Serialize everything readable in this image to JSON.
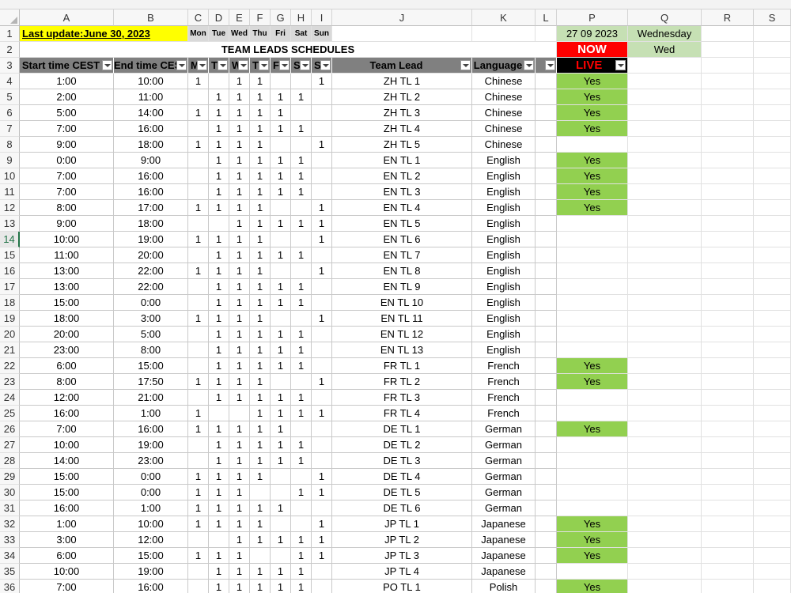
{
  "colors": {
    "yes_green": "#92d050",
    "date_green": "#c6e0b4",
    "now_red": "#ff0000",
    "update_yellow": "#ffff00",
    "header_gray": "#808080"
  },
  "columns": [
    "A",
    "B",
    "C",
    "D",
    "E",
    "F",
    "G",
    "H",
    "I",
    "J",
    "K",
    "L",
    "P",
    "Q",
    "R",
    "S"
  ],
  "row1": {
    "update": "Last update:June 30, 2023",
    "days": [
      "Mon",
      "Tue",
      "Wed",
      "Thu",
      "Fri",
      "Sat",
      "Sun"
    ],
    "date": "27 09 2023",
    "weekday": "Wednesday"
  },
  "row2": {
    "title": "TEAM LEADS SCHEDULES",
    "now": "NOW",
    "weekday_short": "Wed"
  },
  "row3": {
    "start": "Start time CEST",
    "end": "End time CEST",
    "day_letters": [
      "M",
      "T",
      "W",
      "T",
      "F",
      "S",
      "S"
    ],
    "team_lead": "Team Lead",
    "language": "Language",
    "live": "LIVE"
  },
  "rows": [
    {
      "n": "4",
      "start": "1:00",
      "end": "10:00",
      "days": [
        "1",
        "",
        "1",
        "1",
        "",
        "",
        "1"
      ],
      "lead": "ZH TL 1",
      "lang": "Chinese",
      "live": "Yes"
    },
    {
      "n": "5",
      "start": "2:00",
      "end": "11:00",
      "days": [
        "",
        "1",
        "1",
        "1",
        "1",
        "1",
        ""
      ],
      "lead": "ZH TL 2",
      "lang": "Chinese",
      "live": "Yes"
    },
    {
      "n": "6",
      "start": "5:00",
      "end": "14:00",
      "days": [
        "1",
        "1",
        "1",
        "1",
        "1",
        "",
        ""
      ],
      "lead": "ZH TL 3",
      "lang": "Chinese",
      "live": "Yes"
    },
    {
      "n": "7",
      "start": "7:00",
      "end": "16:00",
      "days": [
        "",
        "1",
        "1",
        "1",
        "1",
        "1",
        ""
      ],
      "lead": "ZH TL 4",
      "lang": "Chinese",
      "live": "Yes"
    },
    {
      "n": "8",
      "start": "9:00",
      "end": "18:00",
      "days": [
        "1",
        "1",
        "1",
        "1",
        "",
        "",
        "1"
      ],
      "lead": "ZH TL 5",
      "lang": "Chinese",
      "live": ""
    },
    {
      "n": "9",
      "start": "0:00",
      "end": "9:00",
      "days": [
        "",
        "1",
        "1",
        "1",
        "1",
        "1",
        ""
      ],
      "lead": "EN TL 1",
      "lang": "English",
      "live": "Yes"
    },
    {
      "n": "10",
      "start": "7:00",
      "end": "16:00",
      "days": [
        "",
        "1",
        "1",
        "1",
        "1",
        "1",
        ""
      ],
      "lead": "EN TL 2",
      "lang": "English",
      "live": "Yes"
    },
    {
      "n": "11",
      "start": "7:00",
      "end": "16:00",
      "days": [
        "",
        "1",
        "1",
        "1",
        "1",
        "1",
        ""
      ],
      "lead": "EN TL 3",
      "lang": "English",
      "live": "Yes"
    },
    {
      "n": "12",
      "start": "8:00",
      "end": "17:00",
      "days": [
        "1",
        "1",
        "1",
        "1",
        "",
        "",
        "1"
      ],
      "lead": "EN TL 4",
      "lang": "English",
      "live": "Yes"
    },
    {
      "n": "13",
      "start": "9:00",
      "end": "18:00",
      "days": [
        "",
        "",
        "1",
        "1",
        "1",
        "1",
        "1"
      ],
      "lead": "EN TL 5",
      "lang": "English",
      "live": ""
    },
    {
      "n": "14",
      "start": "10:00",
      "end": "19:00",
      "days": [
        "1",
        "1",
        "1",
        "1",
        "",
        "",
        "1"
      ],
      "lead": "EN TL 6",
      "lang": "English",
      "live": ""
    },
    {
      "n": "15",
      "start": "11:00",
      "end": "20:00",
      "days": [
        "",
        "1",
        "1",
        "1",
        "1",
        "1",
        ""
      ],
      "lead": "EN TL 7",
      "lang": "English",
      "live": ""
    },
    {
      "n": "16",
      "start": "13:00",
      "end": "22:00",
      "days": [
        "1",
        "1",
        "1",
        "1",
        "",
        "",
        "1"
      ],
      "lead": "EN TL 8",
      "lang": "English",
      "live": ""
    },
    {
      "n": "17",
      "start": "13:00",
      "end": "22:00",
      "days": [
        "",
        "1",
        "1",
        "1",
        "1",
        "1",
        ""
      ],
      "lead": "EN TL 9",
      "lang": "English",
      "live": ""
    },
    {
      "n": "18",
      "start": "15:00",
      "end": "0:00",
      "days": [
        "",
        "1",
        "1",
        "1",
        "1",
        "1",
        ""
      ],
      "lead": "EN TL 10",
      "lang": "English",
      "live": ""
    },
    {
      "n": "19",
      "start": "18:00",
      "end": "3:00",
      "days": [
        "1",
        "1",
        "1",
        "1",
        "",
        "",
        "1"
      ],
      "lead": "EN TL 11",
      "lang": "English",
      "live": ""
    },
    {
      "n": "20",
      "start": "20:00",
      "end": "5:00",
      "days": [
        "",
        "1",
        "1",
        "1",
        "1",
        "1",
        ""
      ],
      "lead": "EN TL 12",
      "lang": "English",
      "live": ""
    },
    {
      "n": "21",
      "start": "23:00",
      "end": "8:00",
      "days": [
        "",
        "1",
        "1",
        "1",
        "1",
        "1",
        ""
      ],
      "lead": "EN TL 13",
      "lang": "English",
      "live": ""
    },
    {
      "n": "22",
      "start": "6:00",
      "end": "15:00",
      "days": [
        "",
        "1",
        "1",
        "1",
        "1",
        "1",
        ""
      ],
      "lead": "FR TL 1",
      "lang": "French",
      "live": "Yes"
    },
    {
      "n": "23",
      "start": "8:00",
      "end": "17:50",
      "days": [
        "1",
        "1",
        "1",
        "1",
        "",
        "",
        "1"
      ],
      "lead": "FR TL 2",
      "lang": "French",
      "live": "Yes"
    },
    {
      "n": "24",
      "start": "12:00",
      "end": "21:00",
      "days": [
        "",
        "1",
        "1",
        "1",
        "1",
        "1",
        ""
      ],
      "lead": "FR TL 3",
      "lang": "French",
      "live": ""
    },
    {
      "n": "25",
      "start": "16:00",
      "end": "1:00",
      "days": [
        "1",
        "",
        "",
        "1",
        "1",
        "1",
        "1"
      ],
      "lead": "FR TL 4",
      "lang": "French",
      "live": ""
    },
    {
      "n": "26",
      "start": "7:00",
      "end": "16:00",
      "days": [
        "1",
        "1",
        "1",
        "1",
        "1",
        "",
        ""
      ],
      "lead": "DE TL 1",
      "lang": "German",
      "live": "Yes"
    },
    {
      "n": "27",
      "start": "10:00",
      "end": "19:00",
      "days": [
        "",
        "1",
        "1",
        "1",
        "1",
        "1",
        ""
      ],
      "lead": "DE TL 2",
      "lang": "German",
      "live": ""
    },
    {
      "n": "28",
      "start": "14:00",
      "end": "23:00",
      "days": [
        "",
        "1",
        "1",
        "1",
        "1",
        "1",
        ""
      ],
      "lead": "DE TL 3",
      "lang": "German",
      "live": ""
    },
    {
      "n": "29",
      "start": "15:00",
      "end": "0:00",
      "days": [
        "1",
        "1",
        "1",
        "1",
        "",
        "",
        "1"
      ],
      "lead": "DE TL 4",
      "lang": "German",
      "live": ""
    },
    {
      "n": "30",
      "start": "15:00",
      "end": "0:00",
      "days": [
        "1",
        "1",
        "1",
        "",
        "",
        "1",
        "1"
      ],
      "lead": "DE TL 5",
      "lang": "German",
      "live": ""
    },
    {
      "n": "31",
      "start": "16:00",
      "end": "1:00",
      "days": [
        "1",
        "1",
        "1",
        "1",
        "1",
        "",
        ""
      ],
      "lead": "DE TL 6",
      "lang": "German",
      "live": ""
    },
    {
      "n": "32",
      "start": "1:00",
      "end": "10:00",
      "days": [
        "1",
        "1",
        "1",
        "1",
        "",
        "",
        "1"
      ],
      "lead": "JP TL 1",
      "lang": "Japanese",
      "live": "Yes"
    },
    {
      "n": "33",
      "start": "3:00",
      "end": "12:00",
      "days": [
        "",
        "",
        "1",
        "1",
        "1",
        "1",
        "1"
      ],
      "lead": "JP TL 2",
      "lang": "Japanese",
      "live": "Yes"
    },
    {
      "n": "34",
      "start": "6:00",
      "end": "15:00",
      "days": [
        "1",
        "1",
        "1",
        "",
        "",
        "1",
        "1"
      ],
      "lead": "JP TL 3",
      "lang": "Japanese",
      "live": "Yes"
    },
    {
      "n": "35",
      "start": "10:00",
      "end": "19:00",
      "days": [
        "",
        "1",
        "1",
        "1",
        "1",
        "1",
        ""
      ],
      "lead": "JP TL 4",
      "lang": "Japanese",
      "live": ""
    },
    {
      "n": "36",
      "start": "7:00",
      "end": "16:00",
      "days": [
        "",
        "1",
        "1",
        "1",
        "1",
        "1",
        ""
      ],
      "lead": "PO TL 1",
      "lang": "Polish",
      "live": "Yes"
    }
  ]
}
